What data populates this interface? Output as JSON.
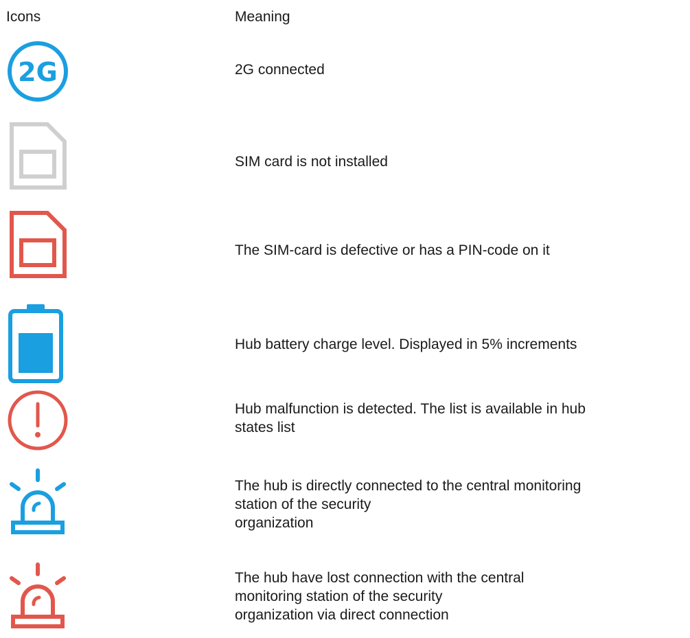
{
  "headers": {
    "icons": "Icons",
    "meaning": "Meaning"
  },
  "colors": {
    "blue": "#1a9fe0",
    "red": "#e2574c",
    "gray": "#cfcfcf",
    "text": "#1a1a1a"
  },
  "rows": [
    {
      "icon": "2g-connected-icon",
      "icon_text": "2G",
      "meaning_lines": [
        "2G connected"
      ]
    },
    {
      "icon": "sim-card-gray-icon",
      "meaning_lines": [
        "SIM card is not installed"
      ]
    },
    {
      "icon": "sim-card-red-icon",
      "meaning_lines": [
        "The SIM-card is defective or has a PIN-code on it"
      ]
    },
    {
      "icon": "battery-icon",
      "meaning_lines": [
        "Hub battery charge level. Displayed in 5% increments"
      ]
    },
    {
      "icon": "alert-circle-icon",
      "meaning_lines": [
        "Hub malfunction is detected. The list is available in hub",
        "states list"
      ]
    },
    {
      "icon": "siren-blue-icon",
      "meaning_lines": [
        "The hub is directly connected to the central monitoring",
        "station of the security",
        "organization"
      ]
    },
    {
      "icon": "siren-red-icon",
      "meaning_lines": [
        "The hub have lost connection with the central",
        "monitoring station of the security",
        "organization via direct connection"
      ]
    }
  ]
}
